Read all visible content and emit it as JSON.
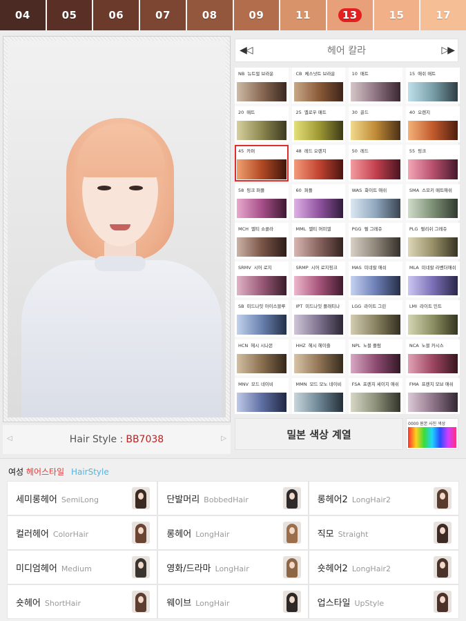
{
  "tabs": [
    {
      "label": "04",
      "color": "#4a2a22"
    },
    {
      "label": "05",
      "color": "#5a2f25"
    },
    {
      "label": "06",
      "color": "#6b3a2a"
    },
    {
      "label": "07",
      "color": "#7d4632"
    },
    {
      "label": "08",
      "color": "#93573d"
    },
    {
      "label": "09",
      "color": "#b26e4c"
    },
    {
      "label": "11",
      "color": "#d9936a"
    },
    {
      "label": "13",
      "color": "#e8a07a",
      "active": true
    },
    {
      "label": "15",
      "color": "#f1b087"
    },
    {
      "label": "17",
      "color": "#f5be95"
    }
  ],
  "photo": {
    "hair_style_label": "Hair Style :",
    "hair_style_code": "BB7038"
  },
  "color_panel": {
    "title": "헤어 칼라",
    "prev": "◀◁",
    "next": "▷▶",
    "swatches": [
      {
        "code": "NB",
        "name": "뉴트럴 브라운",
        "colors": [
          "#cdbba6",
          "#8a6a55",
          "#3a2820"
        ]
      },
      {
        "code": "CB",
        "name": "체스넛트 브라운",
        "colors": [
          "#c7a888",
          "#8c5c3a",
          "#3e241a"
        ]
      },
      {
        "code": "10",
        "name": "매트",
        "colors": [
          "#d6c6c8",
          "#8f7583",
          "#3a2730"
        ]
      },
      {
        "code": "15",
        "name": "애쉬 매트",
        "colors": [
          "#bfe0ea",
          "#7a9fa9",
          "#2f3e44"
        ]
      },
      {
        "code": "20",
        "name": "매트",
        "colors": [
          "#d6d0a0",
          "#8d8750",
          "#3c3a20"
        ]
      },
      {
        "code": "25",
        "name": "옐로우 매트",
        "colors": [
          "#e4e07a",
          "#a09a35",
          "#3d3a18"
        ]
      },
      {
        "code": "30",
        "name": "골드",
        "colors": [
          "#f1d98d",
          "#c08a37",
          "#4a3016"
        ]
      },
      {
        "code": "40",
        "name": "오렌지",
        "colors": [
          "#f4b27a",
          "#c25a2c",
          "#4f1e0e"
        ]
      },
      {
        "code": "45",
        "name": "카퍼",
        "colors": [
          "#f0a070",
          "#b24a25",
          "#3e160a"
        ],
        "selected": true
      },
      {
        "code": "48",
        "name": "레드 오렌지",
        "colors": [
          "#f39a7a",
          "#c44532",
          "#4a1410"
        ]
      },
      {
        "code": "50",
        "name": "레드",
        "colors": [
          "#f39ca0",
          "#c4414f",
          "#4a1420"
        ]
      },
      {
        "code": "55",
        "name": "핑크",
        "colors": [
          "#f3a6b6",
          "#b8506e",
          "#45182a"
        ]
      },
      {
        "code": "58",
        "name": "핑크 퍼플",
        "colors": [
          "#e7a9cc",
          "#a7508a",
          "#3e1830"
        ]
      },
      {
        "code": "60",
        "name": "퍼플",
        "colors": [
          "#ddb0e4",
          "#9355a2",
          "#311c3c"
        ]
      },
      {
        "code": "WAS",
        "name": "화이트 애쉬",
        "colors": [
          "#dbe8f2",
          "#8fa7bd",
          "#3a4452"
        ]
      },
      {
        "code": "SMA",
        "name": "스모키 매트애쉬",
        "colors": [
          "#cfdcc8",
          "#7d8f76",
          "#303a2e"
        ]
      },
      {
        "code": "MCH",
        "name": "멜티 쇼콜라",
        "colors": [
          "#cbb2a5",
          "#7a5548",
          "#2c1c18"
        ]
      },
      {
        "code": "MML",
        "name": "멜티 머미엘",
        "colors": [
          "#d7b6b1",
          "#8a6560",
          "#33221f"
        ]
      },
      {
        "code": "PGG",
        "name": "펄 그레쥬",
        "colors": [
          "#d8d0c4",
          "#8f867a",
          "#35302a"
        ]
      },
      {
        "code": "PLG",
        "name": "펄리쉬 그레쥬",
        "colors": [
          "#ddd6b8",
          "#978f68",
          "#383423"
        ]
      },
      {
        "code": "SRMV",
        "name": "시어 로지",
        "colors": [
          "#e1b3c6",
          "#9a5a78",
          "#3a1c2a"
        ]
      },
      {
        "code": "SRMP",
        "name": "시어 로지핑크",
        "colors": [
          "#edb8cc",
          "#a8567c",
          "#3f1a2c"
        ]
      },
      {
        "code": "MAS",
        "name": "미네랄 애쉬",
        "colors": [
          "#c5d2f0",
          "#6d7fb6",
          "#262e48"
        ]
      },
      {
        "code": "MLA",
        "name": "미네랄 라벤더애쉬",
        "colors": [
          "#ccc6f2",
          "#7a6fb6",
          "#2b2748"
        ]
      },
      {
        "code": "SB",
        "name": "미드나잇 아이스블루",
        "colors": [
          "#c2d2ec",
          "#6a82b0",
          "#243048"
        ]
      },
      {
        "code": "IPT",
        "name": "미드나잇 플래티나",
        "colors": [
          "#cfc6d8",
          "#7f7390",
          "#2c2634"
        ]
      },
      {
        "code": "LGG",
        "name": "라이트 그린",
        "colors": [
          "#d2ccb2",
          "#8a8362",
          "#332f20"
        ]
      },
      {
        "code": "LMI",
        "name": "라이트 민트",
        "colors": [
          "#d4d6b4",
          "#8c8f62",
          "#33351f"
        ]
      },
      {
        "code": "HCN",
        "name": "헤시 시나몬",
        "colors": [
          "#d2bfa2",
          "#8b7050",
          "#33261a"
        ]
      },
      {
        "code": "HHZ",
        "name": "헤시 헤이즐",
        "colors": [
          "#d8c4a8",
          "#927556",
          "#362a1d"
        ]
      },
      {
        "code": "NPL",
        "name": "노블 플럼",
        "colors": [
          "#d7a9c2",
          "#8f4c72",
          "#331827"
        ]
      },
      {
        "code": "NCA",
        "name": "노블 카시스",
        "colors": [
          "#e2a2b4",
          "#9c4660",
          "#38161f"
        ]
      },
      {
        "code": "MNV",
        "name": "모드 네이비",
        "colors": [
          "#c0c9e8",
          "#5f6fa3",
          "#202742"
        ]
      },
      {
        "code": "MMN",
        "name": "모드 모노 네이비",
        "colors": [
          "#c9d6dc",
          "#6e8796",
          "#242f38"
        ]
      },
      {
        "code": "FSA",
        "name": "프렌치 세이지 애쉬",
        "colors": [
          "#d6d8c6",
          "#8d917a",
          "#32342a"
        ]
      },
      {
        "code": "FMA",
        "name": "프렌치 모브 애쉬",
        "colors": [
          "#dcc9d6",
          "#8f7689",
          "#332833"
        ]
      }
    ],
    "sample_button": "밀본 색상 계열",
    "rainbow_label": "0000 원본 사진 색상"
  },
  "hairstyle_section": {
    "title_part1": "여성",
    "title_part2": "헤어스타일",
    "title_part3": "HairStyle",
    "categories": [
      {
        "ko": "세미롱헤어",
        "en": "SemiLong",
        "hair": "#3b2a22"
      },
      {
        "ko": "단발머리",
        "en": "BobbedHair",
        "hair": "#2e2a2a"
      },
      {
        "ko": "롱헤어2",
        "en": "LongHair2",
        "hair": "#5a3a2c"
      },
      {
        "ko": "컬러헤어",
        "en": "ColorHair",
        "hair": "#6b4434"
      },
      {
        "ko": "롱헤어",
        "en": "LongHair",
        "hair": "#9b6f4b"
      },
      {
        "ko": "직모",
        "en": "Straight",
        "hair": "#3d2a24"
      },
      {
        "ko": "미디엄헤어",
        "en": "Medium",
        "hair": "#3a3430"
      },
      {
        "ko": "영화/드라마",
        "en": "LongHair",
        "hair": "#8d6646"
      },
      {
        "ko": "숏헤어2",
        "en": "LongHair2",
        "hair": "#4a3328"
      },
      {
        "ko": "숏헤어",
        "en": "ShortHair",
        "hair": "#5e3e30"
      },
      {
        "ko": "웨이브",
        "en": "LongHair",
        "hair": "#2d2826"
      },
      {
        "ko": "업스타일",
        "en": "UpStyle",
        "hair": "#4b3128"
      }
    ]
  }
}
